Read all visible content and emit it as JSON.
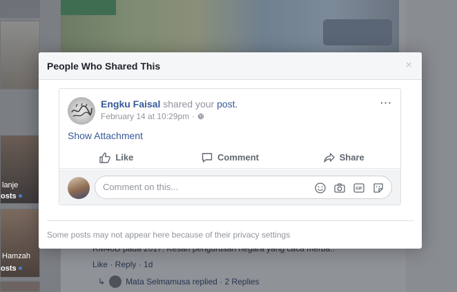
{
  "modal": {
    "title": "People Who Shared This",
    "close_glyph": "×",
    "footer_note": "Some posts may not appear here because of their privacy settings"
  },
  "post": {
    "author": "Engku Faisal",
    "shared_text_1": "shared your",
    "post_link": "post.",
    "timestamp": "February 14 at 10:29pm",
    "separator": "·",
    "audience_icon": "globe-icon",
    "more_label": "···",
    "show_attachment": "Show Attachment",
    "actions": [
      {
        "label": "Like",
        "icon": "thumbs-up-icon"
      },
      {
        "label": "Comment",
        "icon": "comment-bubble-icon"
      },
      {
        "label": "Share",
        "icon": "share-arrow-icon"
      }
    ],
    "comment_placeholder": "Comment on this...",
    "comment_icons": [
      "emoji-icon",
      "camera-icon",
      "gif-icon",
      "sticker-icon"
    ]
  },
  "background": {
    "left_column": [
      {
        "name": "lanje",
        "posts": "osts"
      },
      {
        "name": "Hamzah",
        "posts": "osts"
      }
    ],
    "comment_text": "RM40D pada 2017. Kesan pengurusan negara yang caca merba..",
    "comment_actions": "Like · Reply · 1d",
    "reply_text": "Mata Selmamusa replied · 2 Replies"
  },
  "colors": {
    "link": "#365899",
    "muted": "#90949c",
    "action": "#606770"
  }
}
